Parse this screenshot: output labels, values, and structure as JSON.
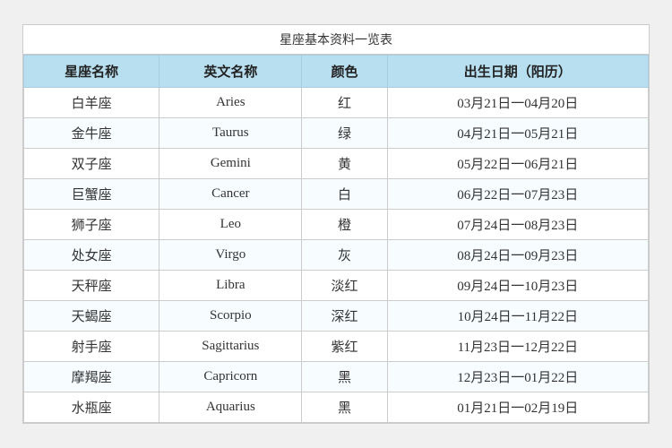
{
  "page": {
    "title": "星座基本资料一览表",
    "headers": [
      "星座名称",
      "英文名称",
      "颜色",
      "出生日期（阳历）"
    ],
    "rows": [
      {
        "chinese": "白羊座",
        "english": "Aries",
        "color": "红",
        "date": "03月21日一04月20日"
      },
      {
        "chinese": "金牛座",
        "english": "Taurus",
        "color": "绿",
        "date": "04月21日一05月21日"
      },
      {
        "chinese": "双子座",
        "english": "Gemini",
        "color": "黄",
        "date": "05月22日一06月21日"
      },
      {
        "chinese": "巨蟹座",
        "english": "Cancer",
        "color": "白",
        "date": "06月22日一07月23日"
      },
      {
        "chinese": "狮子座",
        "english": "Leo",
        "color": "橙",
        "date": "07月24日一08月23日"
      },
      {
        "chinese": "处女座",
        "english": "Virgo",
        "color": "灰",
        "date": "08月24日一09月23日"
      },
      {
        "chinese": "天秤座",
        "english": "Libra",
        "color": "淡红",
        "date": "09月24日一10月23日"
      },
      {
        "chinese": "天蝎座",
        "english": "Scorpio",
        "color": "深红",
        "date": "10月24日一11月22日"
      },
      {
        "chinese": "射手座",
        "english": "Sagittarius",
        "color": "紫红",
        "date": "11月23日一12月22日"
      },
      {
        "chinese": "摩羯座",
        "english": "Capricorn",
        "color": "黑",
        "date": "12月23日一01月22日"
      },
      {
        "chinese": "水瓶座",
        "english": "Aquarius",
        "color": "黑",
        "date": "01月21日一02月19日"
      }
    ]
  }
}
